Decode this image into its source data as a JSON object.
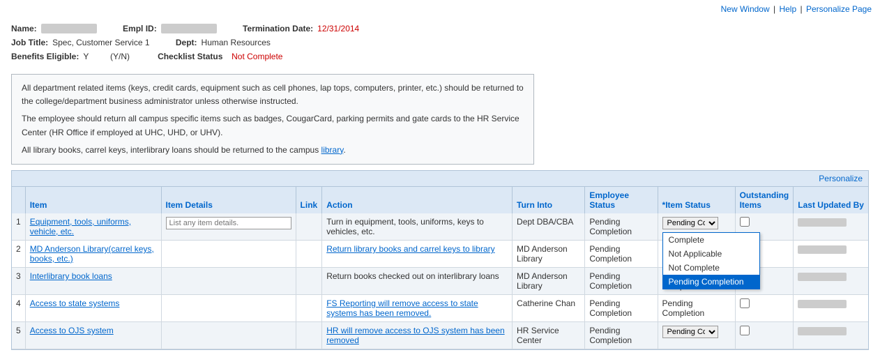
{
  "topbar": {
    "new_window": "New Window",
    "help": "Help",
    "personalize_page": "Personalize Page"
  },
  "header": {
    "name_label": "Name:",
    "empl_id_label": "Empl ID:",
    "termination_date_label": "Termination Date:",
    "termination_date_value": "12/31/2014",
    "job_title_label": "Job Title:",
    "job_title_value": "Spec, Customer Service 1",
    "dept_label": "Dept:",
    "dept_value": "Human Resources",
    "benefits_eligible_label": "Benefits Eligible:",
    "benefits_eligible_value": "Y",
    "benefits_yn": "(Y/N)",
    "checklist_status_label": "Checklist Status",
    "checklist_status_value": "Not Complete"
  },
  "info_box": {
    "para1": "All department related items (keys, credit cards, equipment such as cell phones, lap tops, computers, printer, etc.) should be returned to the college/department business administrator unless otherwise instructed.",
    "para2": "The employee should return all campus specific items such as badges, CougarCard, parking permits and gate cards to the HR Service Center (HR Office if employed at UHC, UHD, or UHV).",
    "para3_prefix": "All library books, carrel keys, interlibrary loans should be returned to the campus ",
    "para3_link": "library",
    "para3_suffix": "."
  },
  "table": {
    "personalize_label": "Personalize",
    "columns": [
      "",
      "Item",
      "Item Details",
      "Link",
      "Action",
      "Turn Into",
      "Employee Status",
      "*Item Status",
      "Outstanding Items",
      "Last Updated By"
    ],
    "rows": [
      {
        "num": "1",
        "item": "Equipment, tools, uniforms, vehicle, etc.",
        "item_details_placeholder": "List any item details.",
        "link": "",
        "action": "Turn in equipment, tools, uniforms, keys to vehicles, etc.",
        "turn_into": "Dept DBA/CBA",
        "employee_status": "Pending Completion",
        "item_status": "Pending Co",
        "outstanding": false,
        "last_updated": "",
        "has_dropdown": true,
        "dropdown_options": [
          "Complete",
          "Not Applicable",
          "Not Complete",
          "Pending Completion"
        ],
        "dropdown_selected": "Pending Completion"
      },
      {
        "num": "2",
        "item": "MD Anderson Library(carrel keys, books, etc.)",
        "item_details_placeholder": "",
        "link": "",
        "action": "Return library books and carrel keys to library",
        "turn_into": "MD Anderson Library",
        "employee_status": "Pending Completion",
        "item_status": "",
        "outstanding": false,
        "last_updated": "",
        "has_dropdown": false
      },
      {
        "num": "3",
        "item": "Interlibrary book loans",
        "item_details_placeholder": "",
        "link": "",
        "action": "Return books checked out on interlibrary loans",
        "turn_into": "MD Anderson Library",
        "employee_status": "Pending Completion",
        "item_status": "Pending Completion",
        "outstanding": false,
        "last_updated": "",
        "has_dropdown": false
      },
      {
        "num": "4",
        "item": "Access to state systems",
        "item_details_placeholder": "",
        "link": "",
        "action": "FS Reporting will remove access to state systems has been removed.",
        "turn_into": "Catherine Chan",
        "employee_status": "Pending Completion",
        "item_status": "Pending Completion",
        "outstanding": false,
        "last_updated": "",
        "has_dropdown": false
      },
      {
        "num": "5",
        "item": "Access to OJS system",
        "item_details_placeholder": "",
        "link": "",
        "action": "HR will remove access to OJS system has been removed",
        "turn_into": "HR Service Center",
        "employee_status": "Pending Completion",
        "item_status": "Pending Co",
        "outstanding": false,
        "last_updated": "",
        "has_dropdown": true,
        "dropdown_options": [
          "Complete",
          "Not Applicable",
          "Not Complete",
          "Pending Completion"
        ],
        "dropdown_selected": ""
      }
    ]
  }
}
